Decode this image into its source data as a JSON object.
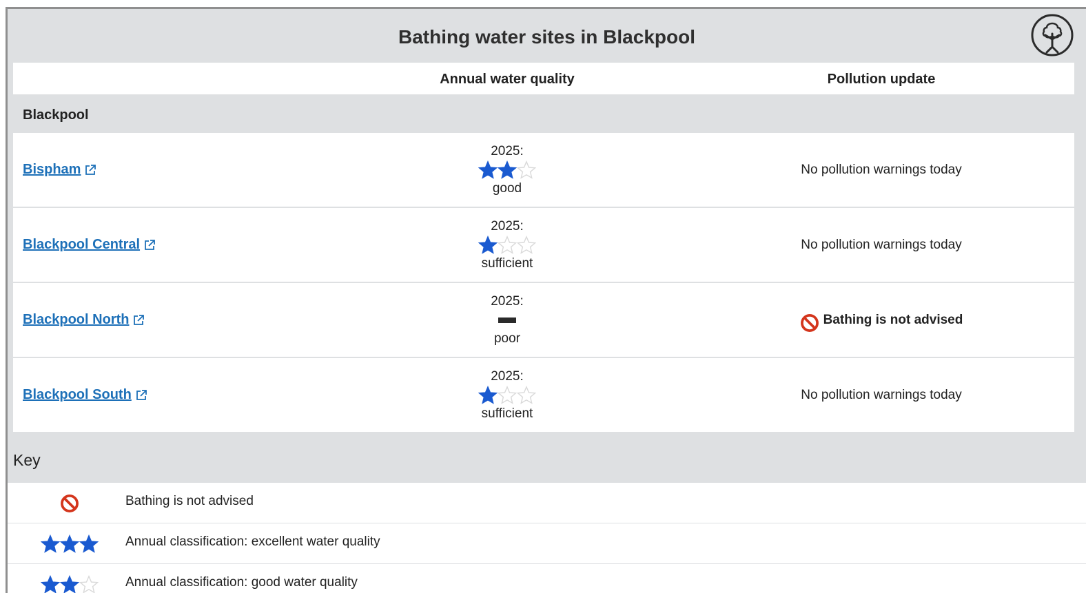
{
  "title": "Bathing water sites in Blackpool",
  "logo_icon": "environment-agency-logo-icon",
  "columns": {
    "quality": "Annual water quality",
    "pollution": "Pollution update"
  },
  "group_name": "Blackpool",
  "sites": [
    {
      "name": "Bispham",
      "year": "2025:",
      "stars": 2,
      "classification": "good",
      "pollution": "No pollution warnings today",
      "warning": false
    },
    {
      "name": "Blackpool Central",
      "year": "2025:",
      "stars": 1,
      "classification": "sufficient",
      "pollution": "No pollution warnings today",
      "warning": false
    },
    {
      "name": "Blackpool North",
      "year": "2025:",
      "stars": 0,
      "classification": "poor",
      "pollution": "Bathing is not advised",
      "warning": true
    },
    {
      "name": "Blackpool South",
      "year": "2025:",
      "stars": 1,
      "classification": "sufficient",
      "pollution": "No pollution warnings today",
      "warning": false
    }
  ],
  "key": {
    "title": "Key",
    "items": [
      {
        "icon": "no-bathing-icon",
        "text": "Bathing is not advised"
      },
      {
        "icon": "three-stars-icon",
        "stars": 3,
        "text": "Annual classification: excellent water quality"
      },
      {
        "icon": "two-stars-icon",
        "stars": 2,
        "text": "Annual classification: good water quality"
      }
    ]
  },
  "colors": {
    "star_filled": "#1a5ad0",
    "star_empty": "#d9d9d9",
    "link": "#1d70b8",
    "warning": "#d4351c",
    "background": "#dee0e2"
  }
}
